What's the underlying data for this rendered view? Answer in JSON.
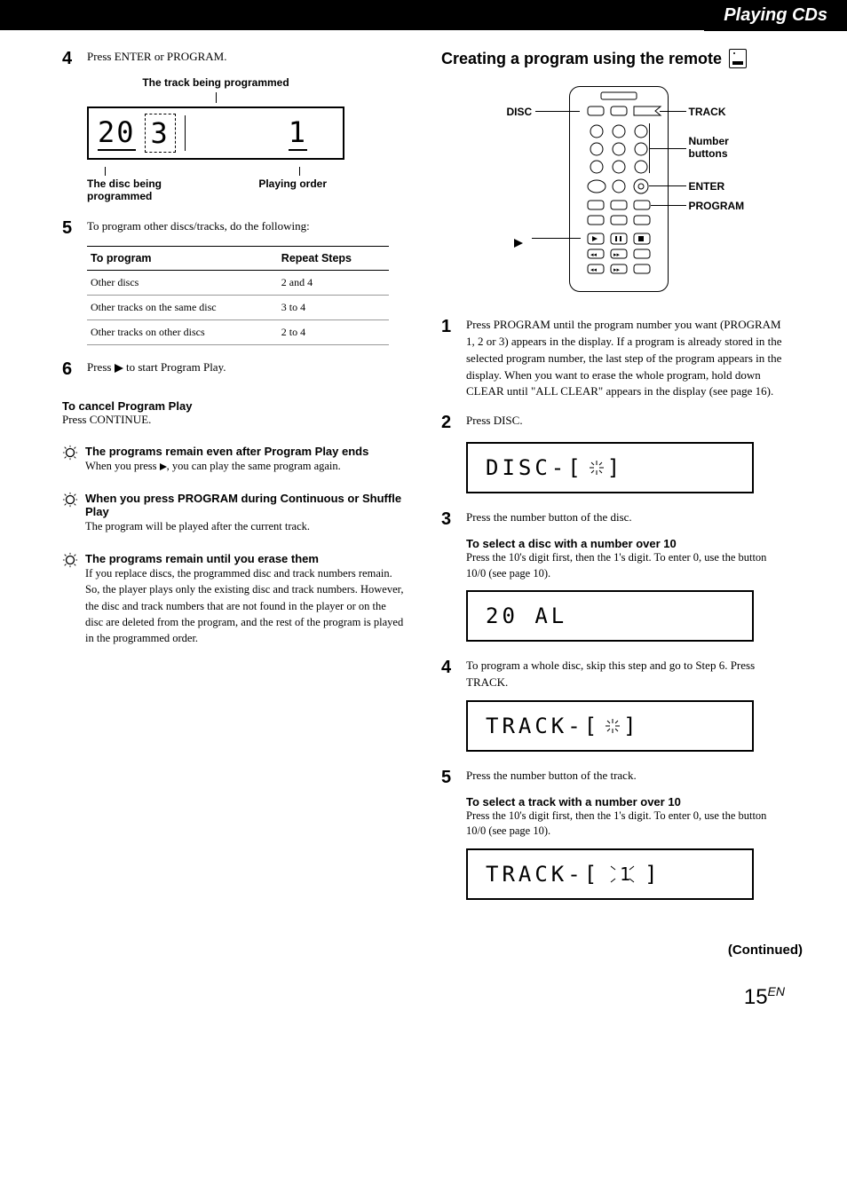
{
  "section_tab": "Playing CDs",
  "left": {
    "step4_text": "Press ENTER or PROGRAM.",
    "lcd1": {
      "top_label": "The track being programmed",
      "big1": "20",
      "big2": "3",
      "big3": "1",
      "disc_label": "The disc being programmed",
      "order_label": "Playing order"
    },
    "step5_text": "To program other discs/tracks, do the following:",
    "table": {
      "h1": "To program",
      "h2": "Repeat Steps",
      "rows": [
        [
          "Other discs",
          "2 and 4"
        ],
        [
          "Other tracks on the same disc",
          "3 to 4"
        ],
        [
          "Other tracks on other discs",
          "2 to 4"
        ]
      ]
    },
    "step6_before": "Press ",
    "step6_after": " to start Program Play.",
    "cancel_head": "To cancel Program Play",
    "cancel_body": "Press CONTINUE.",
    "tip1_head": "The programs remain even after Program Play ends",
    "tip1_body_before": "When you press ",
    "tip1_body_after": ", you can play the same program again.",
    "tip2_head": "When you press PROGRAM during Continuous or Shuffle Play",
    "tip2_body": "The program will be played after the current track.",
    "tip3_head": "The programs remain until you erase them",
    "tip3_body": "If you replace discs, the programmed disc and track numbers remain. So, the player plays only the existing disc and track numbers. However, the disc and track numbers that are not found in the player or on the disc are deleted from the program, and the rest of the program is played in the programmed order."
  },
  "right": {
    "title": "Creating a program using the remote",
    "labels": {
      "disc": "DISC",
      "track": "TRACK",
      "numbers": "Number buttons",
      "enter": "ENTER",
      "program": "PROGRAM",
      "play_symbol": "▶"
    },
    "step1": "Press PROGRAM until the program number you want (PROGRAM 1, 2 or 3) appears in the display. If a program is already stored in the selected program number, the last step of the program appears in the display. When you want to erase the whole program, hold down CLEAR until \"ALL CLEAR\" appears in the display (see page 16).",
    "step2": "Press DISC.",
    "lcd_disc": "DISC-[",
    "lcd_disc_tail": "]",
    "step3": "Press the number button of the disc.",
    "disc_over10_head": "To select a disc with a number over 10",
    "disc_over10_body": "Press the 10's digit first, then the 1's digit. To enter 0, use the button 10/0 (see page 10).",
    "lcd_20al": "20 AL",
    "step4": "To program a whole disc, skip this step and go to Step 6. Press TRACK.",
    "lcd_track": "TRACK-[",
    "lcd_track_tail": "]",
    "step5": "Press the number button of the track.",
    "track_over10_head": "To select a track with a number over 10",
    "track_over10_body": "Press the 10's digit first, then the 1's digit. To enter 0, use the button 10/0 (see page 10).",
    "lcd_track2": "TRACK-[",
    "lcd_track2_digit": "1",
    "lcd_track2_tail": "]"
  },
  "continued": "(Continued)",
  "page_number": "15",
  "page_lang": "EN"
}
